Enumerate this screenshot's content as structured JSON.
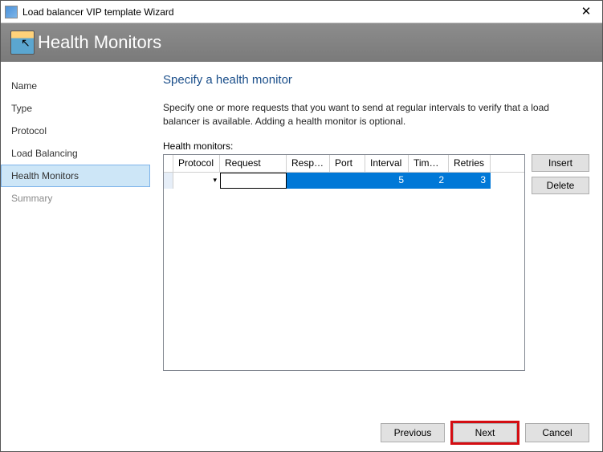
{
  "window": {
    "title": "Load balancer VIP template Wizard",
    "close_glyph": "✕"
  },
  "header": {
    "page_title": "Health Monitors"
  },
  "nav": {
    "items": [
      {
        "label": "Name",
        "state": "normal"
      },
      {
        "label": "Type",
        "state": "normal"
      },
      {
        "label": "Protocol",
        "state": "normal"
      },
      {
        "label": "Load Balancing",
        "state": "normal"
      },
      {
        "label": "Health Monitors",
        "state": "selected"
      },
      {
        "label": "Summary",
        "state": "disabled"
      }
    ]
  },
  "content": {
    "heading": "Specify a health monitor",
    "description": "Specify one or more requests that you want to send at regular intervals to verify that a load balancer is available. Adding a health monitor is optional.",
    "grid_label": "Health monitors:",
    "columns": {
      "protocol": "Protocol",
      "request": "Request",
      "response": "Respo...",
      "port": "Port",
      "interval": "Interval",
      "timeout": "Time-...",
      "retries": "Retries"
    },
    "row": {
      "protocol": "",
      "request": "",
      "response": "",
      "port": "",
      "interval": "5",
      "timeout": "2",
      "retries": "3"
    },
    "buttons": {
      "insert": "Insert",
      "delete": "Delete"
    }
  },
  "footer": {
    "previous": "Previous",
    "next": "Next",
    "cancel": "Cancel"
  }
}
